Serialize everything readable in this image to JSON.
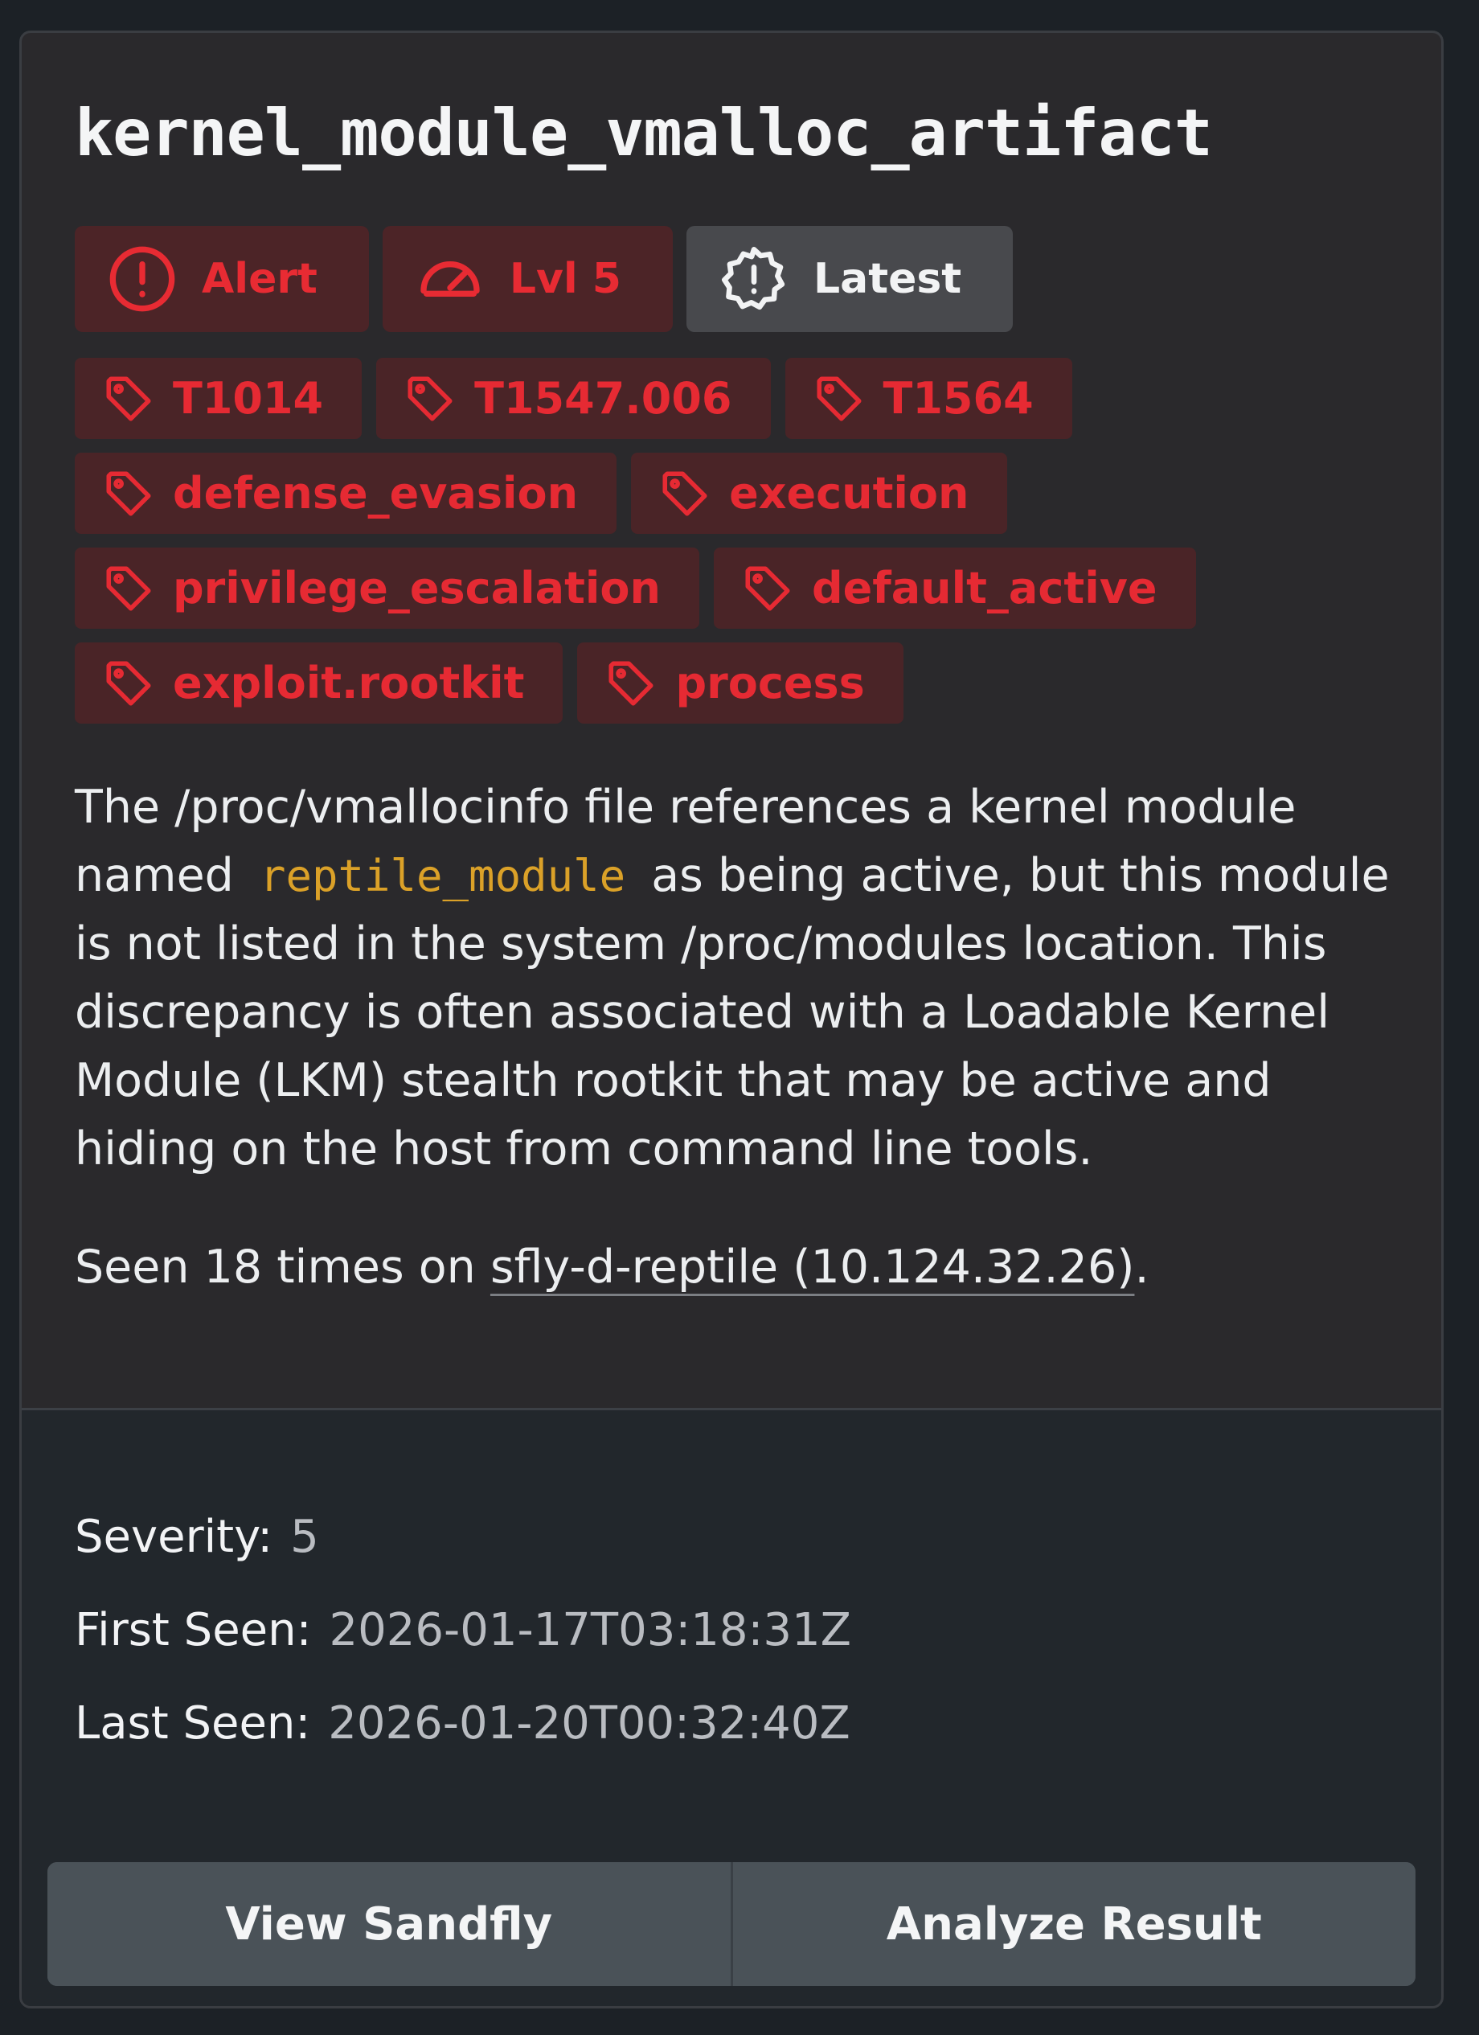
{
  "card": {
    "title": "kernel_module_vmalloc_artifact",
    "badges": [
      {
        "label": "Alert",
        "icon": "alert-circle-icon",
        "style": "red"
      },
      {
        "label": "Lvl 5",
        "icon": "gauge-icon",
        "style": "red"
      },
      {
        "label": "Latest",
        "icon": "badge-alert-icon",
        "style": "gray"
      }
    ],
    "tags": [
      "T1014",
      "T1547.006",
      "T1564",
      "defense_evasion",
      "execution",
      "privilege_escalation",
      "default_active",
      "exploit.rootkit",
      "process"
    ],
    "description": {
      "part1": "The /proc/vmallocinfo file references a kernel module named",
      "module": "reptile_module",
      "part2": "as being active, but this module is not listed in the system /proc/modules location. This discrepancy is often associated with a Loadable Kernel Module (LKM) stealth rootkit that may be active and hiding on the host from command line tools."
    },
    "seen": {
      "prefix": "Seen 18 times on",
      "host": "sfly-d-reptile (10.124.32.26)",
      "suffix": "."
    }
  },
  "meta": {
    "severity_label": "Severity:",
    "severity_value": "5",
    "first_seen_label": "First Seen:",
    "first_seen_value": "2026-01-17T03:18:31Z",
    "last_seen_label": "Last Seen:",
    "last_seen_value": "2026-01-20T00:32:40Z"
  },
  "actions": {
    "view_label": "View Sandfly",
    "analyze_label": "Analyze Result"
  },
  "colors": {
    "background": "#1c2126",
    "card": "#2a292c",
    "red_accent": "#e62a33",
    "red_bg": "#4a2427",
    "mono_accent": "#dba128",
    "button_bg": "#4a5258"
  }
}
